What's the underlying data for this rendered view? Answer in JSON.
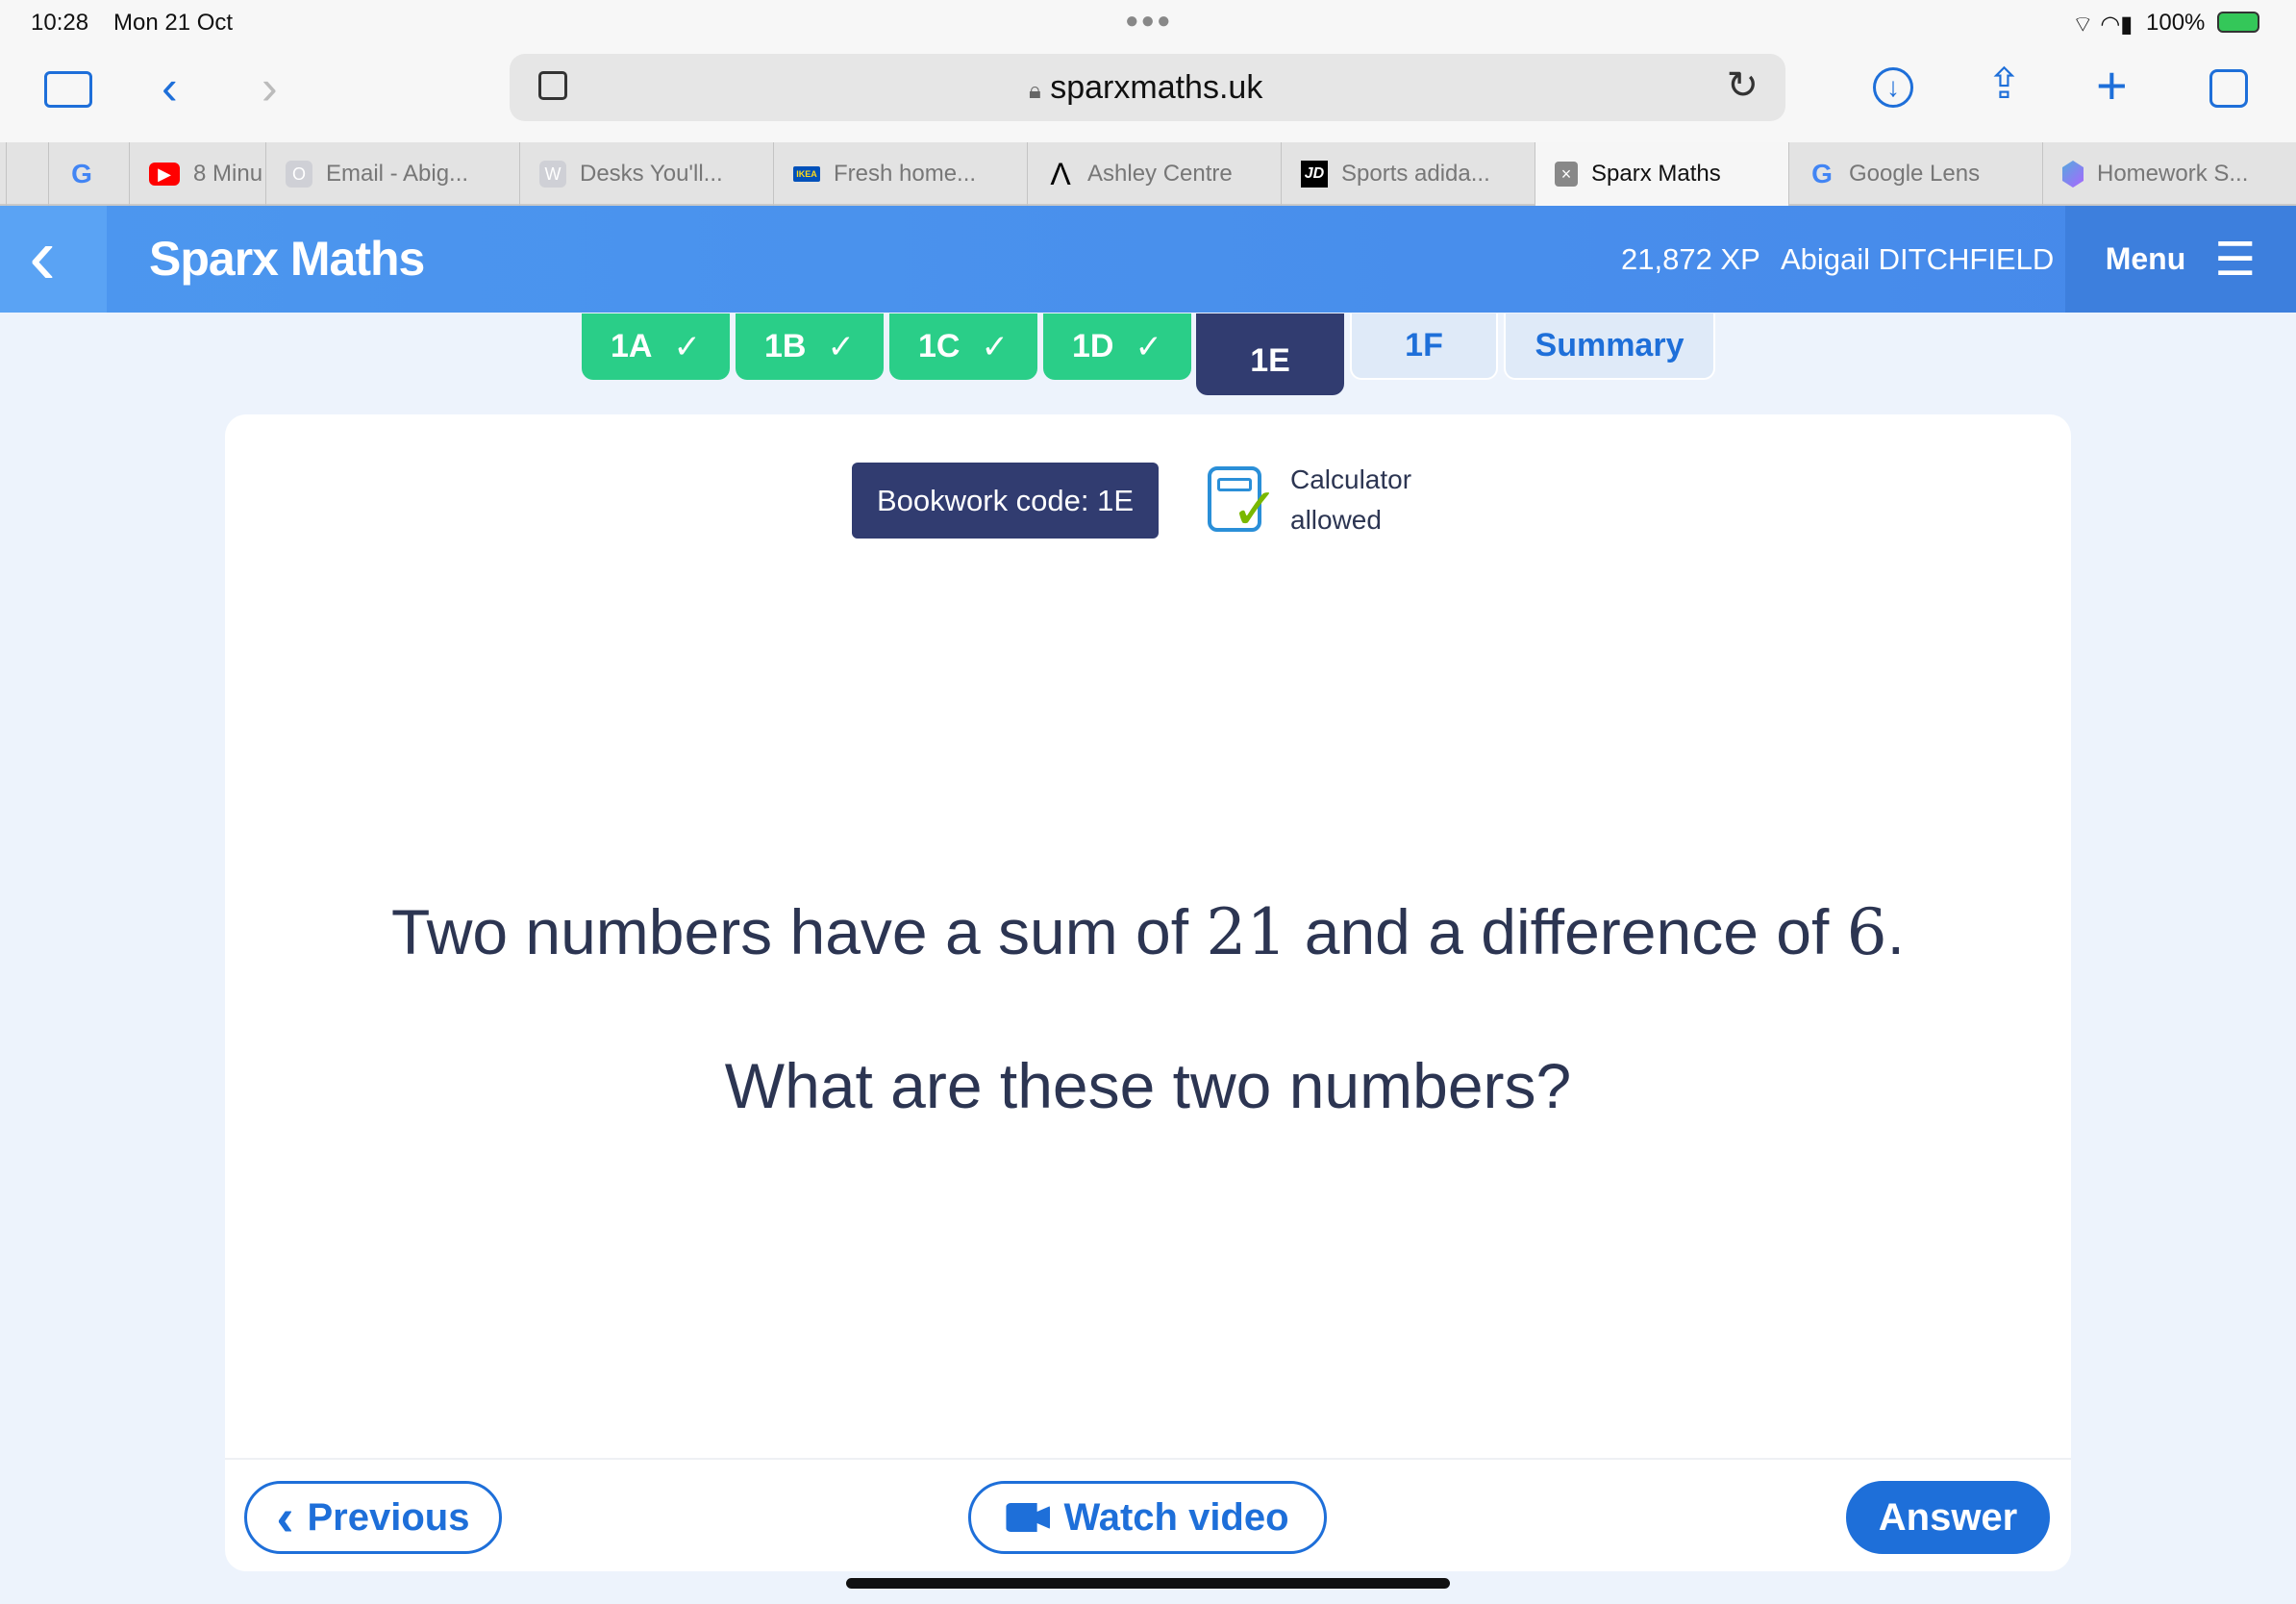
{
  "status": {
    "time": "10:28",
    "date": "Mon 21 Oct",
    "battery": "100%"
  },
  "browser": {
    "url": "sparxmaths.uk",
    "tabs": [
      {
        "label": "",
        "icon": "google-icon"
      },
      {
        "label": "8 Minu",
        "icon": "youtube-icon"
      },
      {
        "label": "Email - Abig...",
        "icon": "outlook-icon",
        "glyph": "O"
      },
      {
        "label": "Desks You'll...",
        "icon": "w-icon",
        "glyph": "W"
      },
      {
        "label": "Fresh home...",
        "icon": "ikea-icon",
        "glyph": "IKEA"
      },
      {
        "label": "Ashley Centre",
        "icon": "ashley-icon"
      },
      {
        "label": "Sports adida...",
        "icon": "jd-icon",
        "glyph": "JD"
      },
      {
        "label": "Sparx Maths",
        "icon": "sparx-icon",
        "glyph": "×",
        "active": true
      },
      {
        "label": "Google Lens",
        "icon": "google-icon"
      },
      {
        "label": "Homework S...",
        "icon": "gauth-icon"
      }
    ]
  },
  "header": {
    "title": "Sparx Maths",
    "xp": "21,872 XP",
    "user": "Abigail DITCHFIELD",
    "menu": "Menu",
    "color": "#4a90e8"
  },
  "task_tabs": [
    {
      "label": "1A",
      "done": true
    },
    {
      "label": "1B",
      "done": true
    },
    {
      "label": "1C",
      "done": true
    },
    {
      "label": "1D",
      "done": true
    },
    {
      "label": "1E",
      "current": true
    },
    {
      "label": "1F"
    },
    {
      "label": "Summary"
    }
  ],
  "question": {
    "bookwork": "Bookwork code: 1E",
    "calc_line1": "Calculator",
    "calc_line2": "allowed",
    "line1_a": "Two numbers have a sum of ",
    "sum": "21",
    "line1_b": " and a difference of ",
    "diff": "6",
    "line1_c": ".",
    "line2": "What are these two numbers?"
  },
  "buttons": {
    "previous": "Previous",
    "watch": "Watch video",
    "answer": "Answer"
  }
}
